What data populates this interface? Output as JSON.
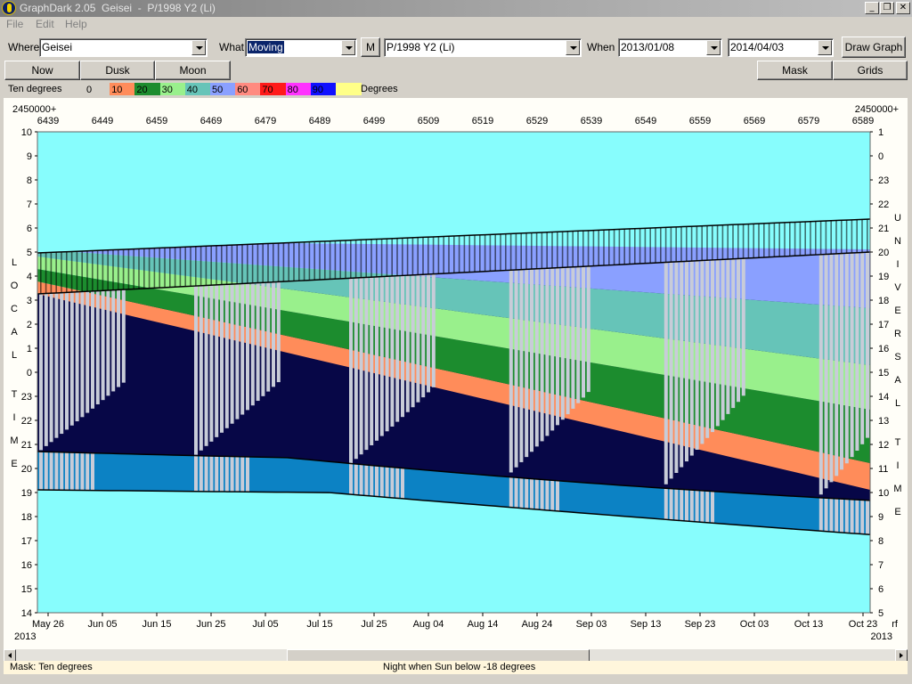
{
  "window": {
    "title": "GraphDark 2.05  Geisei  -  P/1998 Y2 (Li)",
    "controls": [
      "_",
      "❐",
      "✕"
    ]
  },
  "menu": [
    "File",
    "Edit",
    "Help"
  ],
  "controls": {
    "where_label": "Where",
    "where_value": "Geisei",
    "what_label": "What",
    "what_value": "Moving",
    "m_button": "M",
    "object_value": "P/1998 Y2 (Li)",
    "when_label": "When",
    "start_date": "2013/01/08",
    "end_date": "2014/04/03",
    "draw_button": "Draw Graph"
  },
  "toolbar": {
    "now": "Now",
    "dusk": "Dusk",
    "moon": "Moon",
    "mask": "Mask",
    "grids": "Grids"
  },
  "legend": {
    "title": "Ten degrees",
    "unit": "Degrees",
    "bands": [
      {
        "label": "0",
        "color": "#d4d0c8"
      },
      {
        "label": "10",
        "color": "#ff8c5a"
      },
      {
        "label": "20",
        "color": "#1c8c2e"
      },
      {
        "label": "30",
        "color": "#99f08c"
      },
      {
        "label": "40",
        "color": "#66c4b8"
      },
      {
        "label": "50",
        "color": "#8aa0ff"
      },
      {
        "label": "60",
        "color": "#ff8a80"
      },
      {
        "label": "70",
        "color": "#ff1a1a"
      },
      {
        "label": "80",
        "color": "#ff33ff"
      },
      {
        "label": "90",
        "color": "#1010ff"
      },
      {
        "label": "",
        "color": "#ffff88"
      }
    ]
  },
  "chart_data": {
    "type": "heatmap",
    "jd_prefix_left": "2450000+",
    "jd_prefix_right": "2450000+",
    "jd_ticks": [
      "6439",
      "6449",
      "6459",
      "6469",
      "6479",
      "6489",
      "6499",
      "6509",
      "6519",
      "6529",
      "6539",
      "6549",
      "6559",
      "6569",
      "6579",
      "6589"
    ],
    "date_ticks": [
      "May 26",
      "Jun 05",
      "Jun 15",
      "Jun 25",
      "Jul 05",
      "Jul 15",
      "Jul 25",
      "Aug 04",
      "Aug 14",
      "Aug 24",
      "Sep 03",
      "Sep 13",
      "Sep 23",
      "Oct 03",
      "Oct 13",
      "Oct 23"
    ],
    "year_left": "2013",
    "year_right": "2013",
    "right_corner": "rf",
    "left_axis_label": "LOCAL TIME",
    "right_axis_label": "UNIVERSAL TIME",
    "local_time_ticks": [
      "10",
      "9",
      "8",
      "7",
      "6",
      "5",
      "4",
      "3",
      "2",
      "1",
      "0",
      "23",
      "22",
      "21",
      "20",
      "19",
      "18",
      "17",
      "16",
      "15",
      "14"
    ],
    "universal_time_ticks": [
      "1",
      "0",
      "23",
      "22",
      "21",
      "20",
      "19",
      "18",
      "17",
      "16",
      "15",
      "14",
      "13",
      "12",
      "11",
      "10",
      "9",
      "8",
      "7",
      "6",
      "5"
    ],
    "series_colors": {
      "day": "#87fdfd",
      "twilight": "#0c82c4",
      "night": "#070747",
      "moonlit": "#c8ccd8",
      "alt_0_10": "#ff8c5a",
      "alt_10_20": "#1c8c2e",
      "alt_20_30": "#99f08c",
      "alt_30_40": "#66c4b8",
      "alt_40_50": "#8aa0ff"
    }
  },
  "status": {
    "mask": "Mask:  Ten degrees",
    "message": "Night when Sun below -18 degrees"
  }
}
